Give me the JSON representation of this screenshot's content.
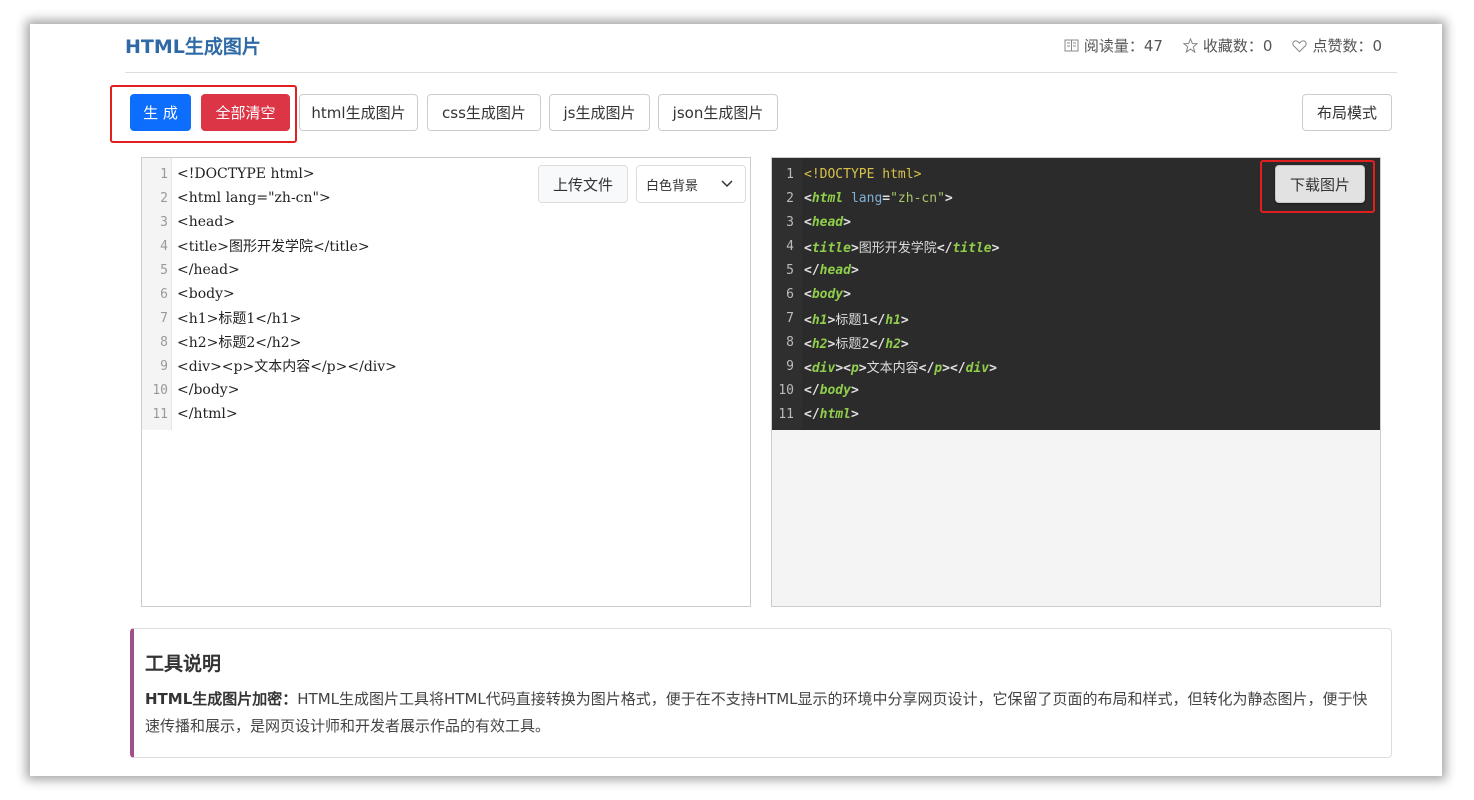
{
  "header": {
    "title": "HTML生成图片",
    "stats": [
      {
        "icon": "read-count-icon",
        "label": "阅读量：47"
      },
      {
        "icon": "star-icon",
        "label": "收藏数：0"
      },
      {
        "icon": "heart-icon",
        "label": "点赞数：0"
      }
    ]
  },
  "toolbar": {
    "generate_label": "生 成",
    "clear_label": "全部清空",
    "tabs": [
      "html生成图片",
      "css生成图片",
      "js生成图片",
      "json生成图片"
    ],
    "layout_label": "布局模式"
  },
  "editor": {
    "upload_label": "上传文件",
    "background_select": "白色背景",
    "lines": [
      "<!DOCTYPE html>",
      "<html lang=\"zh-cn\">",
      "<head>",
      "<title>图形开发学院</title>",
      "</head>",
      "<body>",
      "<h1>标题1</h1>",
      "<h2>标题2</h2>",
      "<div><p>文本内容</p></div>",
      "</body>",
      "</html>"
    ]
  },
  "preview": {
    "download_label": "下载图片",
    "line_numbers": [
      "1",
      "2",
      "3",
      "4",
      "5",
      "6",
      "7",
      "8",
      "9",
      "10",
      "11"
    ],
    "doctype": "<!DOCTYPE html>",
    "html_attr": "lang",
    "html_attr_value": "\"zh-cn\"",
    "title_text": "图形开发学院",
    "h1_text": "标题1",
    "h2_text": "标题2",
    "p_text": "文本内容"
  },
  "info": {
    "title": "工具说明",
    "bold_lead": "HTML生成图片加密：",
    "text": "HTML生成图片工具将HTML代码直接转换为图片格式，便于在不支持HTML显示的环境中分享网页设计，它保留了页面的布局和样式，但转化为静态图片，便于快速传播和展示，是网页设计师和开发者展示作品的有效工具。"
  },
  "colors": {
    "primary": "#0d6efd",
    "danger": "#dc3545",
    "title_blue": "#2f6aa6",
    "highlight_red": "#e0201e",
    "accent_border": "#a05088"
  }
}
